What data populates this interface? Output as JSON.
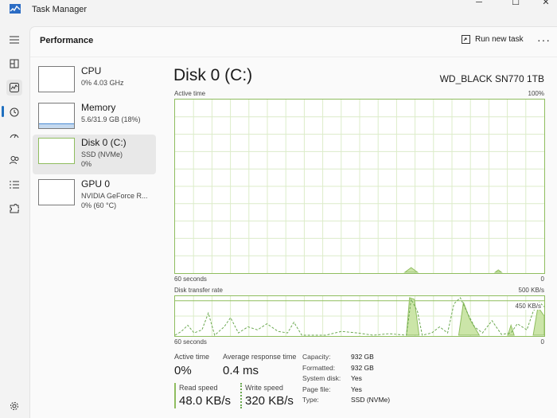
{
  "window": {
    "title": "Task Manager"
  },
  "header": {
    "title": "Performance",
    "run_new_task": "Run new task",
    "more": "···"
  },
  "devices": [
    {
      "name": "CPU",
      "line1": "0% 4.03 GHz",
      "line2": "",
      "level": 0
    },
    {
      "name": "Memory",
      "line1": "5.6/31.9 GB (18%)",
      "line2": "",
      "level": 0.18
    },
    {
      "name": "Disk 0 (C:)",
      "line1": "SSD (NVMe)",
      "line2": "0%",
      "level": 0
    },
    {
      "name": "GPU 0",
      "line1": "NVIDIA GeForce R...",
      "line2": "0% (60 °C)",
      "level": 0
    }
  ],
  "disk": {
    "title": "Disk 0 (C:)",
    "model": "WD_BLACK SN770 1TB",
    "active_time_graph": {
      "label": "Active time",
      "max": "100%",
      "x_left": "60 seconds",
      "x_right": "0"
    },
    "transfer_graph": {
      "label": "Disk transfer rate",
      "max": "500 KB/s",
      "ref": "450 KB/s",
      "x_left": "60 seconds",
      "x_right": "0"
    },
    "stats": {
      "active_time": {
        "label": "Active time",
        "value": "0%"
      },
      "avg_response": {
        "label": "Average response time",
        "value": "0.4 ms"
      },
      "read_speed": {
        "label": "Read speed",
        "value": "48.0 KB/s"
      },
      "write_speed": {
        "label": "Write speed",
        "value": "320 KB/s"
      }
    },
    "properties": [
      {
        "key": "Capacity:",
        "value": "932 GB"
      },
      {
        "key": "Formatted:",
        "value": "932 GB"
      },
      {
        "key": "System disk:",
        "value": "Yes"
      },
      {
        "key": "Page file:",
        "value": "Yes"
      },
      {
        "key": "Type:",
        "value": "SSD (NVMe)"
      }
    ]
  },
  "colors": {
    "accent": "#1f6fbf",
    "disk_line": "#8fbd5f",
    "disk_fill": "#cbe5a8",
    "memory_fill": "#c5d9ef"
  }
}
